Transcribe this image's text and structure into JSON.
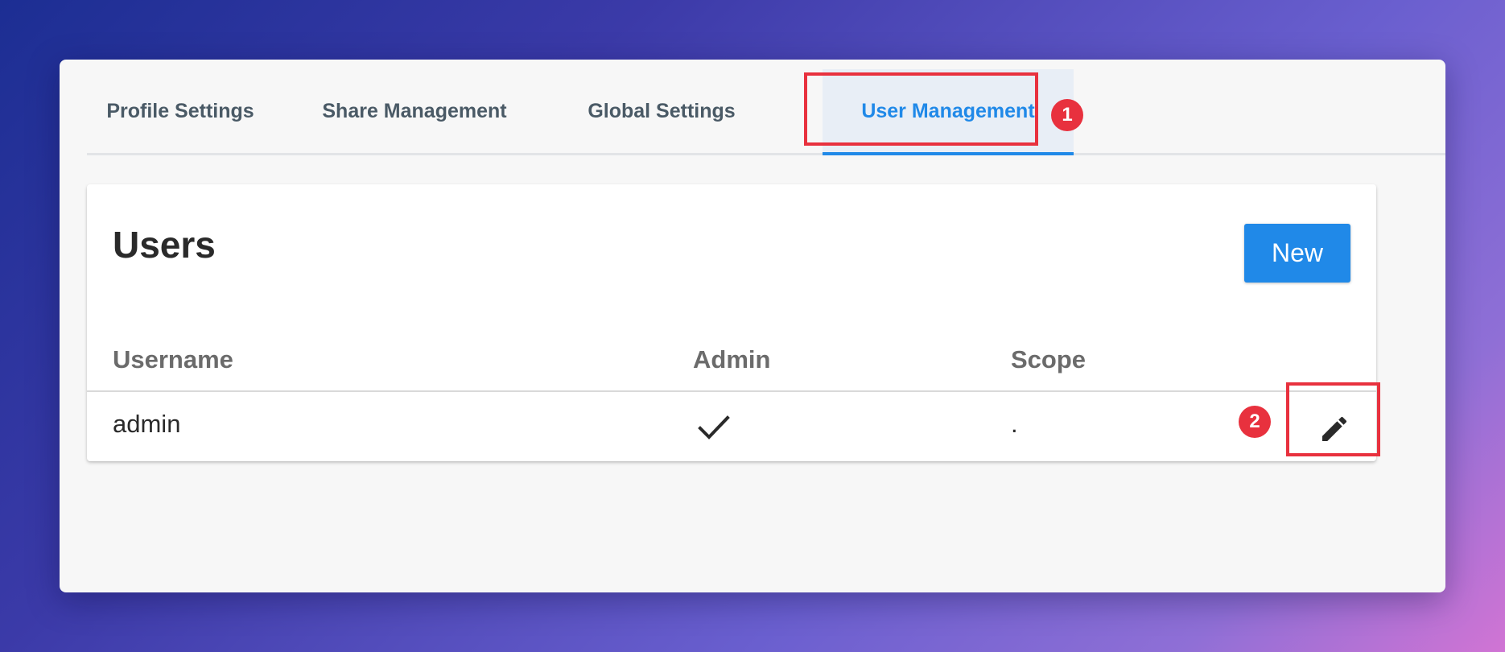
{
  "tabs": [
    {
      "label": "Profile Settings",
      "active": false
    },
    {
      "label": "Share Management",
      "active": false
    },
    {
      "label": "Global Settings",
      "active": false
    },
    {
      "label": "User Management",
      "active": true
    }
  ],
  "annotations": {
    "step1": "1",
    "step2": "2",
    "highlight_color": "#e8313e"
  },
  "users": {
    "title": "Users",
    "new_label": "New",
    "columns": {
      "username": "Username",
      "admin": "Admin",
      "scope": "Scope"
    },
    "rows": [
      {
        "username": "admin",
        "admin": true,
        "admin_icon": "check-icon",
        "scope": ".",
        "action_icon": "edit-icon"
      }
    ]
  },
  "colors": {
    "accent": "#2089e8",
    "window_bg": "#f7f7f7",
    "text": "#2a2a2a"
  }
}
